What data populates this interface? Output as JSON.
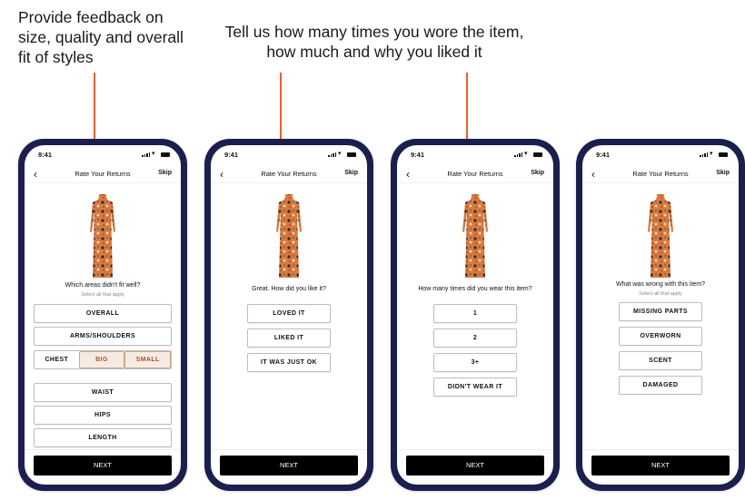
{
  "captions": {
    "left": "Provide feedback on size, quality and overall fit of styles",
    "center": "Tell us how many times you wore the item, how much and why you liked it"
  },
  "colors": {
    "accent": "#e8612c",
    "phone_frame": "#1a1f4e",
    "selected_bg": "#f6ebe2",
    "selected_text": "#a0522d"
  },
  "phones": [
    {
      "status_time": "9:41",
      "nav_title": "Rate Your Returns",
      "skip_label": "Skip",
      "question": "Which areas didn't fit well?",
      "subtitle": "Select all that apply",
      "options": [
        "OVERALL",
        "ARMS/SHOULDERS",
        "WAIST",
        "HIPS",
        "LENGTH"
      ],
      "chest": {
        "label": "CHEST",
        "big": "BIG",
        "small": "SMALL"
      },
      "next_label": "NEXT"
    },
    {
      "status_time": "9:41",
      "nav_title": "Rate Your Returns",
      "skip_label": "Skip",
      "question": "Great. How did you like it?",
      "options": [
        "LOVED IT",
        "LIKED IT",
        "IT WAS JUST OK"
      ],
      "next_label": "NEXT"
    },
    {
      "status_time": "9:41",
      "nav_title": "Rate Your Returns",
      "skip_label": "Skip",
      "question": "How many times did you wear this item?",
      "options": [
        "1",
        "2",
        "3+",
        "DIDN'T WEAR IT"
      ],
      "next_label": "NEXT"
    },
    {
      "status_time": "9:41",
      "nav_title": "Rate Your Returns",
      "skip_label": "Skip",
      "question": "What was wrong with this item?",
      "subtitle": "Select all that apply",
      "options": [
        "MISSING PARTS",
        "OVERWORN",
        "SCENT",
        "DAMAGED"
      ],
      "next_label": "NEXT"
    }
  ]
}
